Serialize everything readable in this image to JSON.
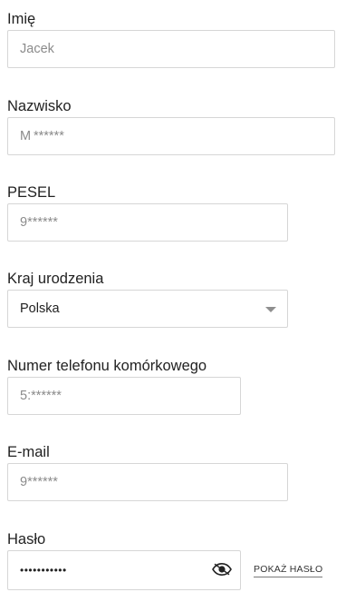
{
  "form": {
    "first_name": {
      "label": "Imię",
      "value": "Jacek"
    },
    "last_name": {
      "label": "Nazwisko",
      "value": "M ******"
    },
    "pesel": {
      "label": "PESEL",
      "value": "9******"
    },
    "birth_country": {
      "label": "Kraj urodzenia",
      "value": "Polska"
    },
    "mobile_phone": {
      "label": "Numer telefonu komórkowego",
      "value": "5:******"
    },
    "email": {
      "label": "E-mail",
      "value": "9******"
    },
    "password": {
      "label": "Hasło",
      "value": "•••••••••••",
      "toggle_icon": "eye-icon",
      "show_label": "POKAŻ HASŁO"
    }
  }
}
